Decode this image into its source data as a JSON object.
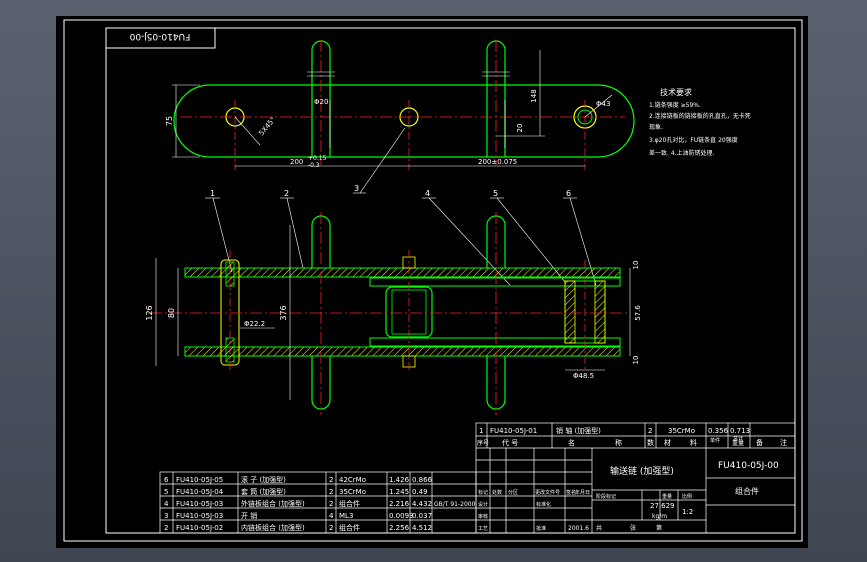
{
  "colors": {
    "frame": "#ffffff",
    "outline": "#00ff00",
    "centerline": "#ff2020",
    "dimension": "#ffffff",
    "hatch": "#ffff00",
    "leader": "#ffffff",
    "pin": "#ffff00",
    "title_text": "#ffffff",
    "cad_background": "#000000"
  },
  "drawing_number_box": "FU410-05J-00",
  "top_view": {
    "dims": {
      "height_75": "75",
      "diameter_20": "Φ20",
      "dim_148": "148",
      "dim_20": "20",
      "diameter_43": "Φ43",
      "chamfer": "5X45°",
      "pitch_left": "200",
      "pitch_left_tol_upper": "+0.15",
      "pitch_left_tol_lower": "-0.3",
      "pitch_right": "200±0.075"
    }
  },
  "tech_requirements": {
    "title": "技术要求",
    "lines": [
      "1.链条强度 ≥59%.",
      "2.连接链板的链接板的孔直孔，无卡死",
      "现象.",
      "3.φ20孔对比，FU链条直 20强度",
      "差一致. 4.上油防锈处理."
    ]
  },
  "part_callouts": [
    "1",
    "2",
    "3",
    "4",
    "5",
    "6"
  ],
  "front_view": {
    "dims": {
      "overall_126": "126",
      "dim_80": "80",
      "dim_376": "376",
      "diameter_22": "Φ22.2",
      "dim_10_top": "10",
      "dim_57": "57.6",
      "dim_10_bottom": "10",
      "diameter_48": "Φ48.5"
    }
  },
  "bom_lower": {
    "rows": [
      {
        "seq": "6",
        "code": "FU410-05J-05",
        "name": "滚 子 (加强型)",
        "qty": "2",
        "material": "42CrMo",
        "unit_weight": "1.426",
        "total_weight": "0.866"
      },
      {
        "seq": "5",
        "code": "FU410-05J-04",
        "name": "套 筒 (加强型)",
        "qty": "2",
        "material": "35CrMo",
        "unit_weight": "1.245",
        "total_weight": "0.49"
      },
      {
        "seq": "4",
        "code": "FU410-05J-03",
        "name": "外链板组合 (加强型)",
        "qty": "2",
        "material": "组合件",
        "unit_weight": "2.216",
        "total_weight": "4.432"
      },
      {
        "seq": "3",
        "code": "FU410-05J-03",
        "name": "开 销",
        "qty": "4",
        "material": "ML3",
        "unit_weight": "0.0093",
        "total_weight": "0.037"
      },
      {
        "seq": "2",
        "code": "FU410-05J-02",
        "name": "内链板组合 (加强型)",
        "qty": "2",
        "material": "组合件",
        "unit_weight": "2.256",
        "total_weight": "4.512"
      }
    ],
    "standard_note": "GB/T 91-2000"
  },
  "bom_upper": {
    "row": {
      "seq": "1",
      "code": "FU410-05J-01",
      "name": "销 轴 (加强型)",
      "qty": "2",
      "material": "35CrMo",
      "unit_weight": "0.356",
      "total_weight": "0.713"
    },
    "headers": [
      "序号",
      "代 号",
      "名",
      "称",
      "数",
      "材",
      "料",
      "单件",
      "总计",
      "备",
      "注"
    ],
    "weight_header": "重量"
  },
  "title_block": {
    "product_name": "输送链 (加强型)",
    "drawing_number": "FU410-05J-00",
    "assembly_label": "组合件",
    "weight": "27.629",
    "weight_unit": "kg/m",
    "scale": "1:2",
    "year": "2001.6",
    "sign_labels": {
      "marks": "标记",
      "count": "处数",
      "zone": "分区",
      "change_doc": "更改文件号",
      "signature": "签名",
      "date": "年月日",
      "design": "设计",
      "check": "审核",
      "process": "工艺",
      "standardization": "标准化",
      "approve": "批准",
      "stage_mark": "阶段标记",
      "weight_label": "重量",
      "scale_label": "比例",
      "sheet_total": "共",
      "sheet_no": "张",
      "sheet_of": "第"
    }
  }
}
